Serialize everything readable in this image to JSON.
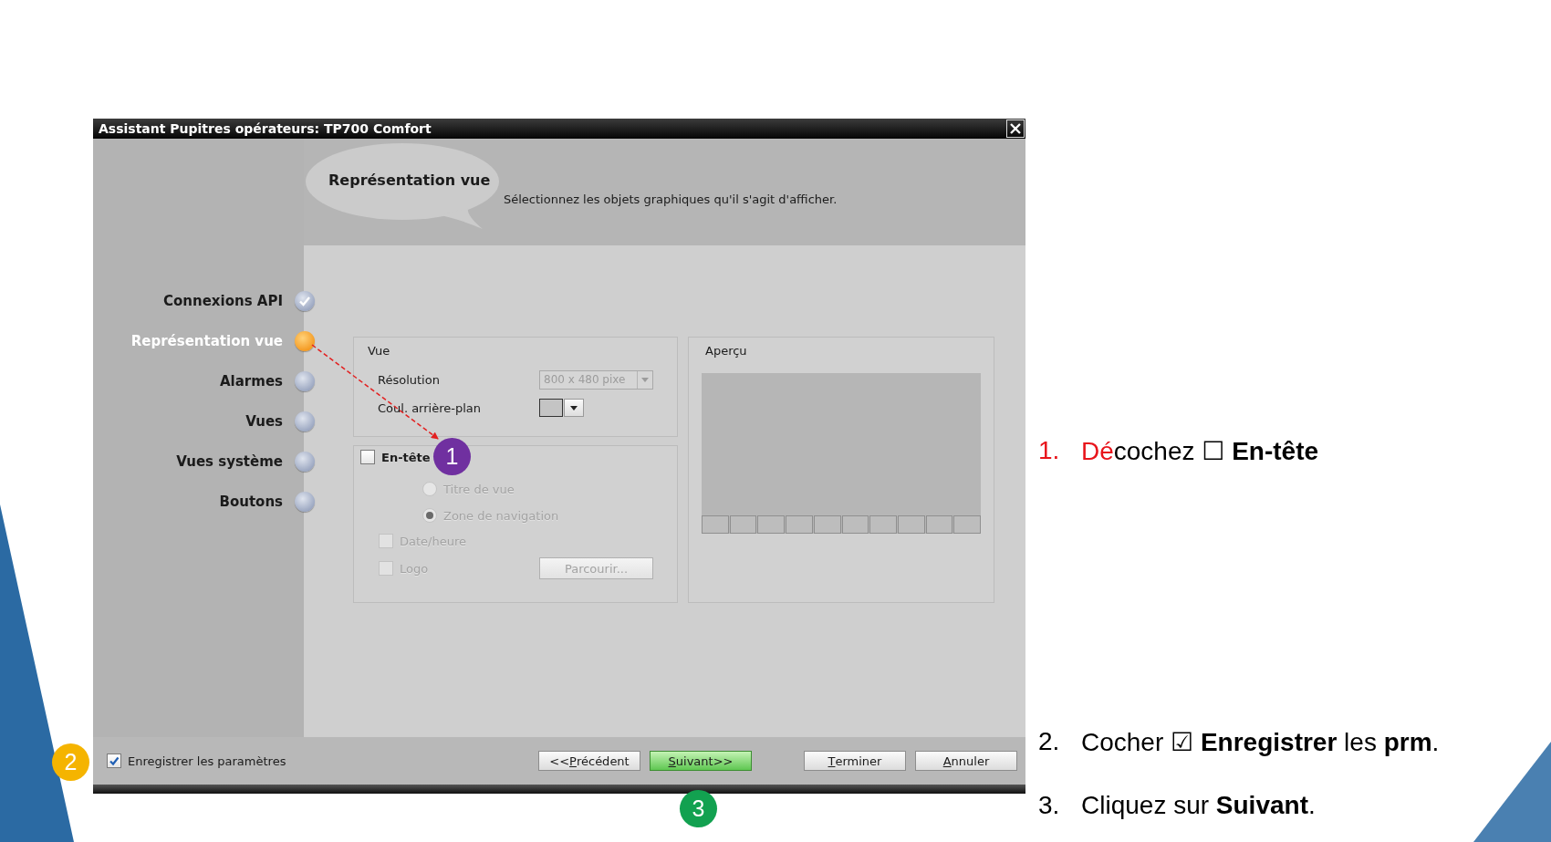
{
  "window": {
    "title": "Assistant Pupitres opérateurs: TP700 Comfort"
  },
  "header": {
    "title": "Représentation vue",
    "description": "Sélectionnez les objets graphiques qu'il s'agit d'afficher."
  },
  "steps": [
    {
      "label": "Connexions API",
      "completed": true,
      "selected": false
    },
    {
      "label": "Représentation vue",
      "completed": false,
      "selected": true
    },
    {
      "label": "Alarmes",
      "completed": false,
      "selected": false
    },
    {
      "label": "Vues",
      "completed": false,
      "selected": false
    },
    {
      "label": "Vues système",
      "completed": false,
      "selected": false
    },
    {
      "label": "Boutons",
      "completed": false,
      "selected": false
    }
  ],
  "view_group": {
    "title": "Vue",
    "resolution": {
      "label": "Résolution",
      "value": "800 x 480 pixe",
      "disabled": true
    },
    "background": {
      "label": "Coul. arrière-plan",
      "color": "#c4c4c4"
    }
  },
  "header_group": {
    "checkbox": {
      "label": "En-tête",
      "checked": false
    },
    "options": [
      {
        "label": "Titre de vue",
        "selected": false,
        "disabled": true
      },
      {
        "label": "Zone de navigation",
        "selected": true,
        "disabled": true
      }
    ],
    "checkboxes": [
      {
        "label": "Date/heure",
        "checked": false,
        "disabled": true
      },
      {
        "label": "Logo",
        "checked": false,
        "disabled": true
      }
    ],
    "browse_button": {
      "label": "Parcourir...",
      "disabled": true
    }
  },
  "preview": {
    "title": "Aperçu"
  },
  "save_settings": {
    "label": "Enregistrer les paramètres",
    "checked": true
  },
  "buttons": [
    {
      "before": "<<",
      "key": "P",
      "after": "récédent",
      "highlighted": false
    },
    {
      "key": "S",
      "after": "uivant>>",
      "highlighted": true
    },
    {
      "key": "T",
      "after": "erminer",
      "highlighted": false
    },
    {
      "key": "A",
      "after": "nnuler",
      "highlighted": false
    }
  ],
  "instructions": [
    {
      "number": "1.",
      "lead": "Dé",
      "text": "cochez ☐ **En-tête**",
      "color": "#e8141b"
    },
    {
      "number": "2.",
      "text": "Cocher ☑ **Enregistrer** les **prm**.",
      "color": "#000000"
    },
    {
      "number": "3.",
      "text": "Cliquez sur **Suivant**.",
      "color": "#000000"
    }
  ],
  "badges": [
    {
      "label": "1",
      "color": "#7030a0"
    },
    {
      "label": "2",
      "color": "#f5b400"
    },
    {
      "label": "3",
      "color": "#12a150"
    }
  ]
}
